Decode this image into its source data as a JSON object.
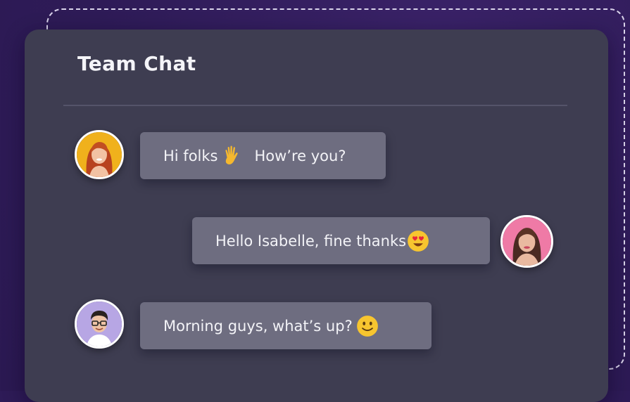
{
  "chat": {
    "title": "Team Chat"
  },
  "messages": [
    {
      "sender": "Isabelle",
      "text_before": "Hi folks",
      "emoji": "waving-hand-icon",
      "text_after": "How’re you?",
      "align": "left"
    },
    {
      "sender": "reply-user",
      "text_before": "Hello Isabelle, fine thanks",
      "emoji": "heart-eyes-emoji-icon",
      "align": "right"
    },
    {
      "sender": "glasses-user",
      "text_before": "Morning guys, what’s up?",
      "emoji": "slightly-smiling-emoji-icon",
      "align": "left"
    }
  ],
  "colors": {
    "background": "#2e1b57",
    "card": "#3e3d51",
    "bubble": "#6e6d80",
    "text": "#f3f3f7"
  }
}
